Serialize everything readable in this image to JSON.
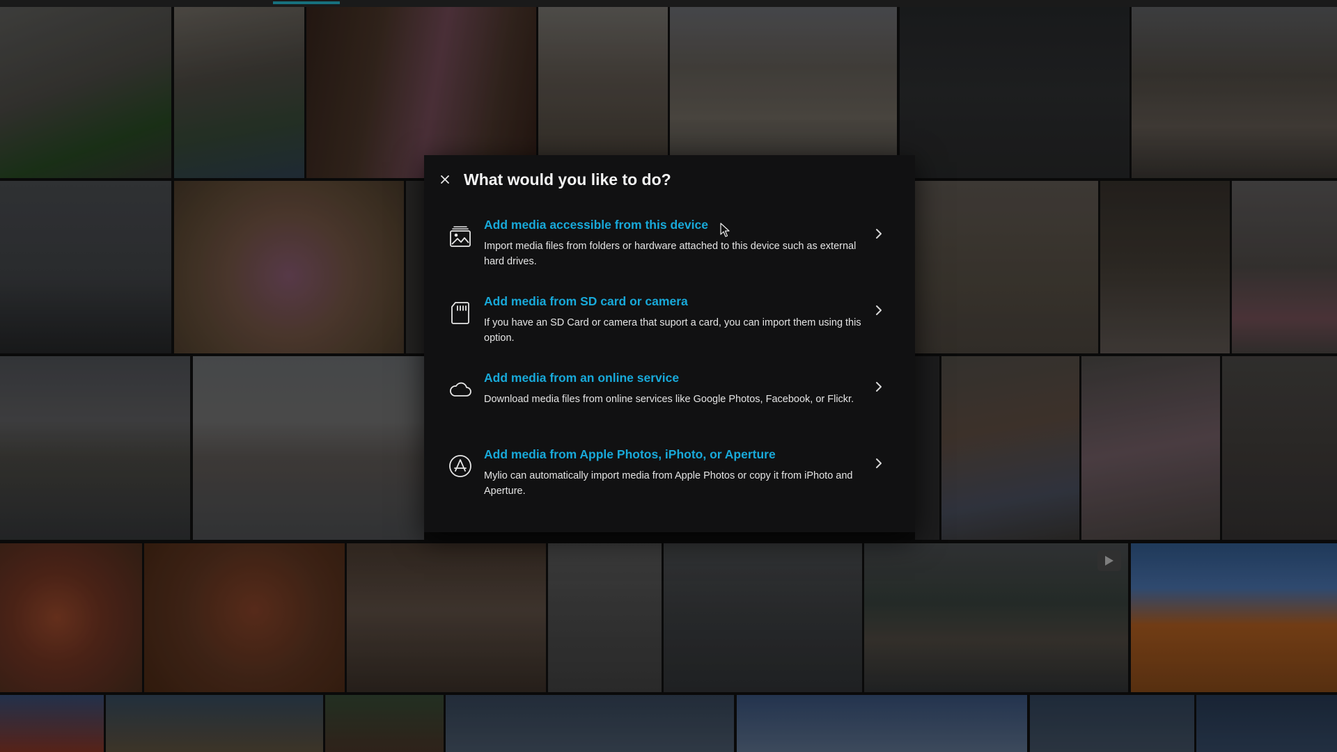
{
  "dialog": {
    "title": "What would you like to do?",
    "close_label": "×",
    "options": [
      {
        "title": "Add media accessible from this device",
        "description": "Import media files from folders or hardware attached to this device such as external hard drives.",
        "icon": "device-photos-icon"
      },
      {
        "title": "Add media from SD card or camera",
        "description": "If you have an SD Card or camera that suport a card, you can import them using this option.",
        "icon": "sd-card-icon"
      },
      {
        "title": "Add media from an online service",
        "description": "Download media files from online services like Google Photos, Facebook, or Flickr.",
        "icon": "cloud-icon"
      },
      {
        "title": "Add media from Apple Photos, iPhoto, or Aperture",
        "description": "Mylio can automatically import media from Apple Photos or copy it from iPhoto and Aperture.",
        "icon": "app-store-icon"
      }
    ]
  },
  "colors": {
    "accent": "#18a9d9",
    "dialog_bg": "#111112",
    "progress": "#17717e"
  }
}
